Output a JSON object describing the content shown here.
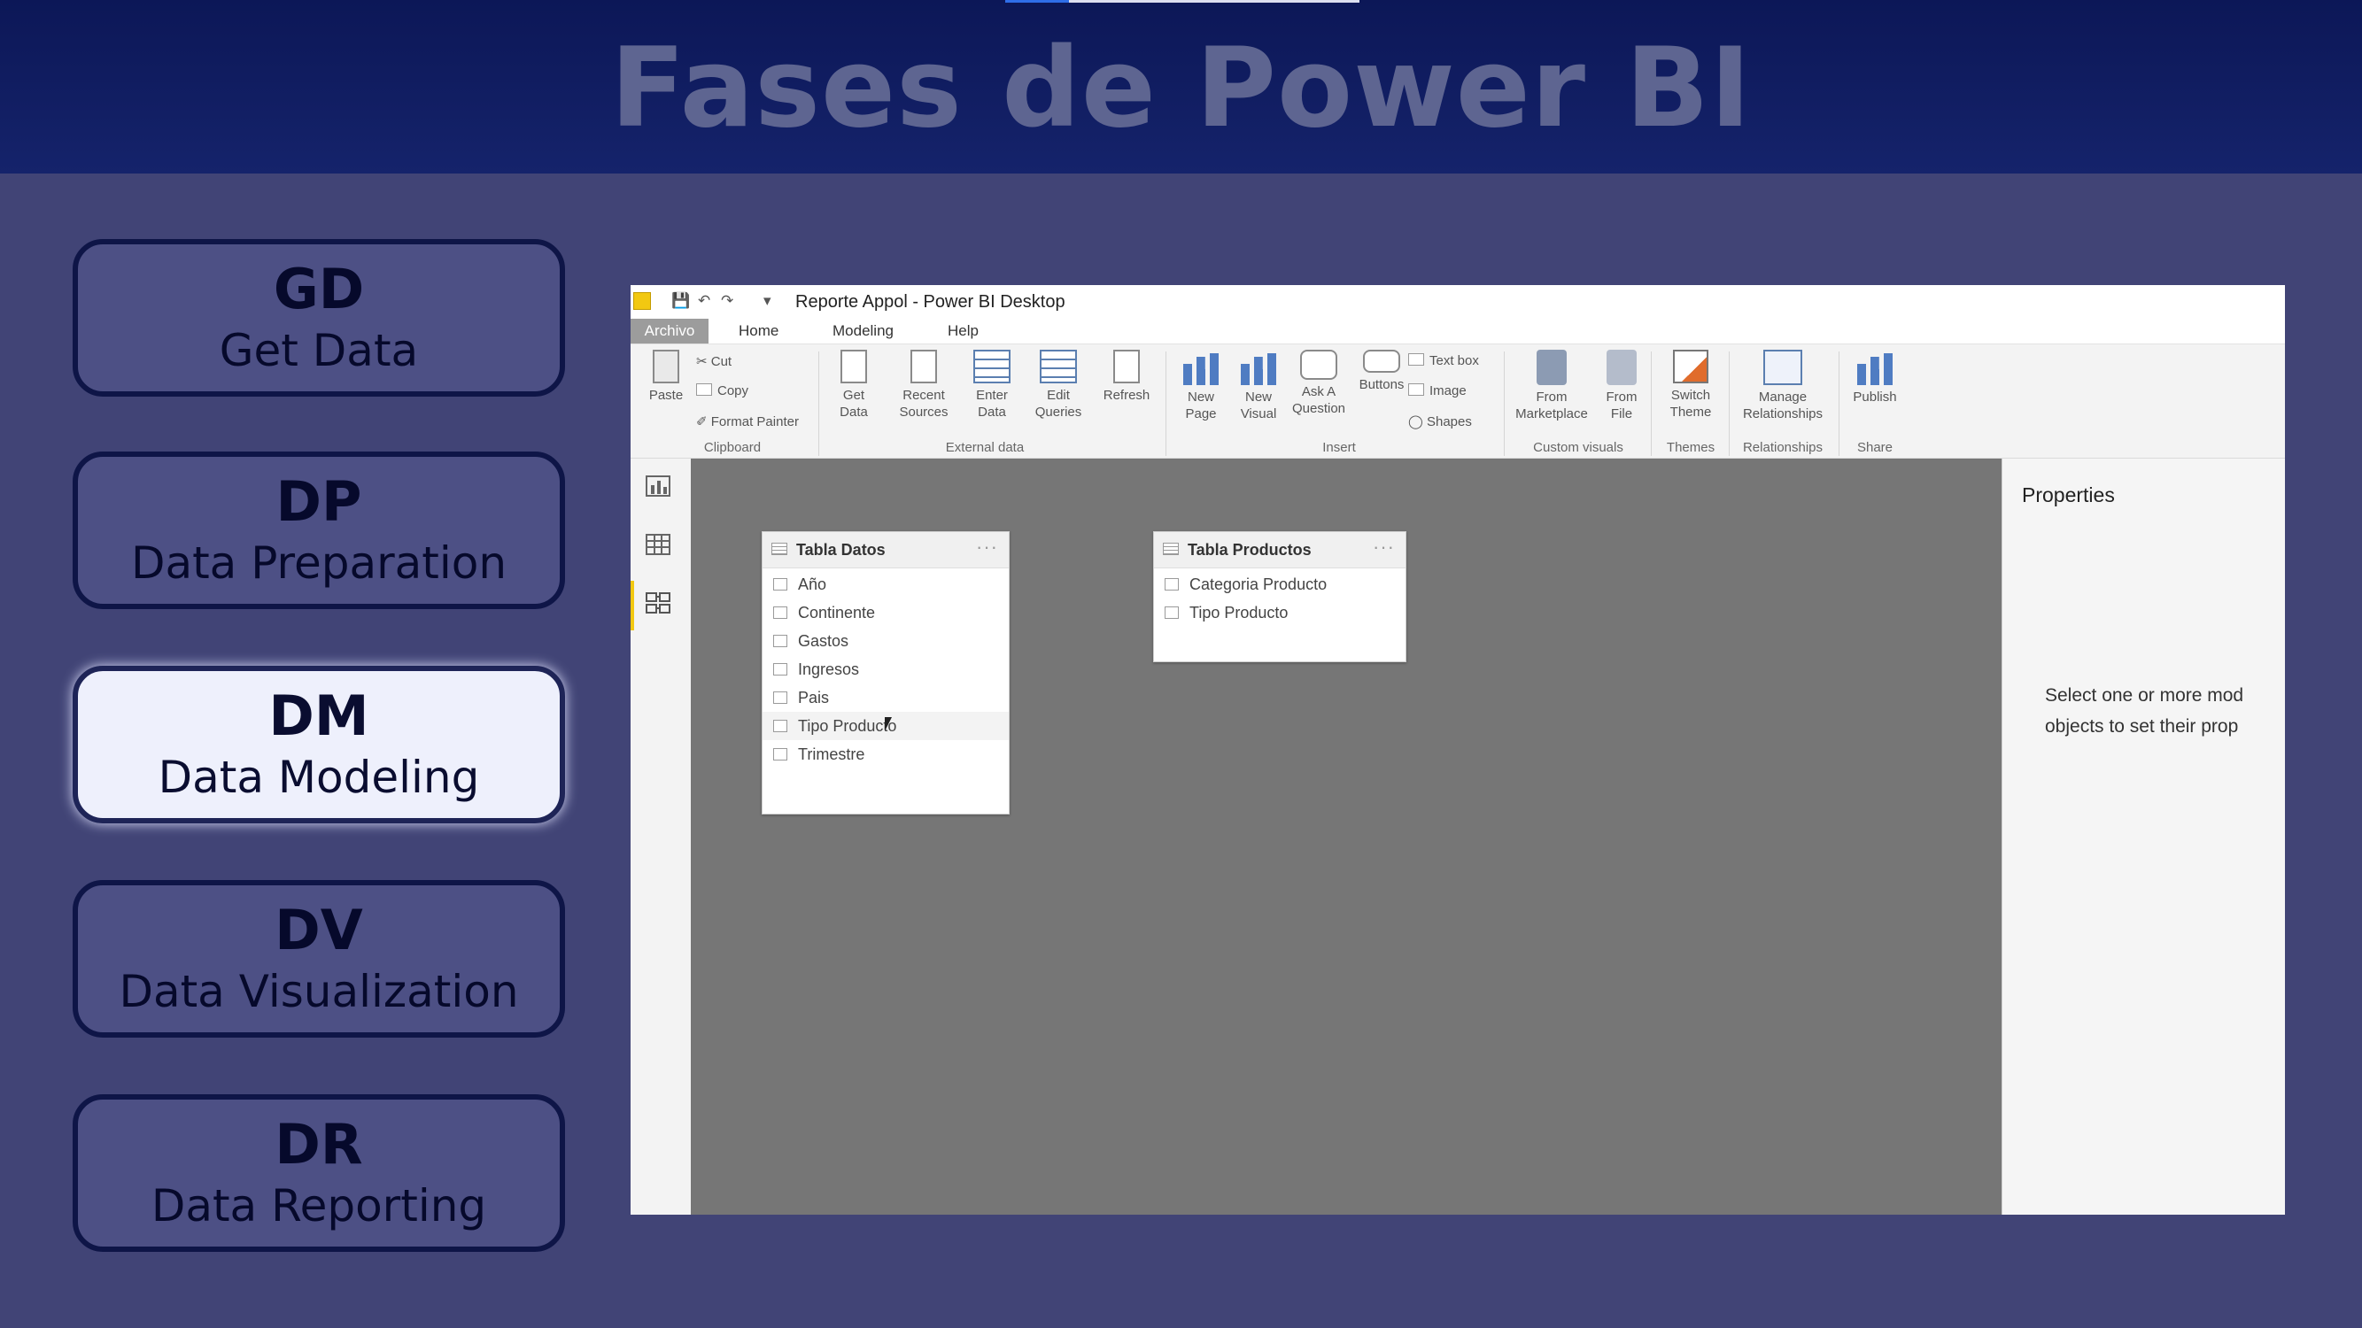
{
  "slide": {
    "title": "Fases de Power BI"
  },
  "phases": [
    {
      "code": "GD",
      "name": "Get Data"
    },
    {
      "code": "DP",
      "name": "Data Preparation"
    },
    {
      "code": "DM",
      "name": "Data Modeling",
      "active": true
    },
    {
      "code": "DV",
      "name": "Data Visualization"
    },
    {
      "code": "DR",
      "name": "Data Reporting"
    }
  ],
  "window": {
    "title": "Reporte Appol - Power BI Desktop"
  },
  "tabs": [
    "Archivo",
    "Home",
    "Modeling",
    "Help"
  ],
  "ribbon": {
    "clipboard": {
      "paste": "Paste",
      "cut": "Cut",
      "copy": "Copy",
      "format_painter": "Format Painter",
      "group": "Clipboard"
    },
    "external": {
      "get_data": "Get Data",
      "recent_sources": "Recent Sources",
      "enter_data": "Enter Data",
      "edit_queries": "Edit Queries",
      "refresh": "Refresh",
      "group": "External data"
    },
    "insert": {
      "new_page": "New Page",
      "new_visual": "New Visual",
      "ask_question": "Ask A Question",
      "buttons": "Buttons",
      "text_box": "Text box",
      "image": "Image",
      "shapes": "Shapes",
      "group": "Insert"
    },
    "custom_visuals": {
      "from_marketplace": "From Marketplace",
      "from_file": "From File",
      "group": "Custom visuals"
    },
    "themes": {
      "switch_theme": "Switch Theme",
      "group": "Themes"
    },
    "relationships": {
      "manage": "Manage Relationships",
      "group": "Relationships"
    },
    "share": {
      "publish": "Publish",
      "group": "Share"
    }
  },
  "tables": [
    {
      "title": "Tabla Datos",
      "fields": [
        "Año",
        "Continente",
        "Gastos",
        "Ingresos",
        "Pais",
        "Tipo Producto",
        "Trimestre"
      ]
    },
    {
      "title": "Tabla Productos",
      "fields": [
        "Categoria Producto",
        "Tipo Producto"
      ]
    }
  ],
  "properties": {
    "title": "Properties",
    "hint_line1": "Select one or more mod",
    "hint_line2": "objects to set their prop"
  },
  "colors": {
    "accent": "#f2c811",
    "slide_bg": "#414476",
    "header_bg": "#0c1757"
  }
}
